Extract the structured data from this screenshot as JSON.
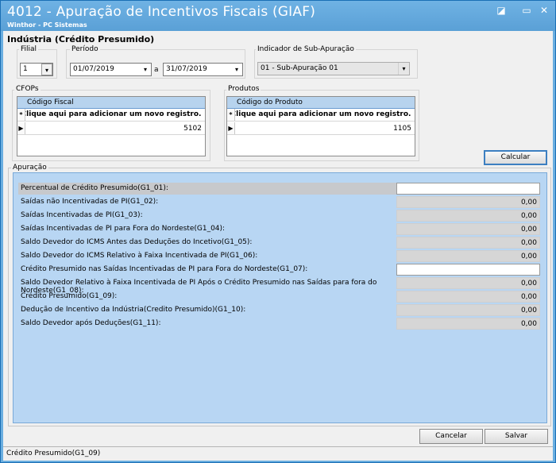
{
  "window": {
    "title": "4012 - Apuração de Incentivos Fiscais (GIAF)",
    "subtitle": "Winthor - PC Sistemas",
    "controls": {
      "restore": "◪",
      "minimize": "▭",
      "close": "✕"
    }
  },
  "form_title": "Indústria (Crédito Presumido)",
  "filial": {
    "label": "Filial",
    "value": "1"
  },
  "periodo": {
    "label": "Período",
    "start": "01/07/2019",
    "separator": "a",
    "end": "31/07/2019"
  },
  "sub_apuracao": {
    "label": "Indicador de Sub-Apuração",
    "value": "01 - Sub-Apuração 01"
  },
  "cfops": {
    "label": "CFOPs",
    "column": "Código Fiscal",
    "new_row_text": "Clique aqui para adicionar um novo registro.",
    "rows": [
      "5102"
    ]
  },
  "produtos": {
    "label": "Produtos",
    "column": "Código do Produto",
    "new_row_text": "Clique aqui para adicionar um novo registro.",
    "rows": [
      "1105"
    ]
  },
  "buttons": {
    "calcular": "Calcular",
    "cancelar": "Cancelar",
    "salvar": "Salvar"
  },
  "apuracao": {
    "label": "Apuração",
    "rows": [
      {
        "label": "Percentual de Crédito Presumido(G1_01):",
        "value": "",
        "editable": true
      },
      {
        "label": "Saídas não Incentivadas de PI(G1_02):",
        "value": "0,00",
        "editable": false
      },
      {
        "label": "Saídas Incentivadas de PI(G1_03):",
        "value": "0,00",
        "editable": false
      },
      {
        "label": "Saídas Incentivadas de PI para Fora do Nordeste(G1_04):",
        "value": "0,00",
        "editable": false
      },
      {
        "label": "Saldo Devedor do ICMS Antes das Deduções do Incetivo(G1_05):",
        "value": "0,00",
        "editable": false
      },
      {
        "label": "Saldo Devedor do ICMS Relativo à Faixa Incentivada de PI(G1_06):",
        "value": "0,00",
        "editable": false
      },
      {
        "label": "Crédito Presumido nas Saídas Incentivadas de PI para Fora do Nordeste(G1_07):",
        "value": "",
        "editable": true
      },
      {
        "label": "Saldo Devedor Relativo à Faixa Incentivada de PI Após o Crédito Presumido nas Saídas para fora do Nordeste(G1_08):",
        "value": "0,00",
        "editable": false
      },
      {
        "label": "Crédito Presumido(G1_09):",
        "value": "0,00",
        "editable": false
      },
      {
        "label": "Dedução de Incentivo da Indústria(Credito Presumido)(G1_10):",
        "value": "0,00",
        "editable": false
      },
      {
        "label": "Saldo Devedor após Deduções(G1_11):",
        "value": "0,00",
        "editable": false
      }
    ]
  },
  "status_bar": "Crédito Presumido(G1_09)"
}
